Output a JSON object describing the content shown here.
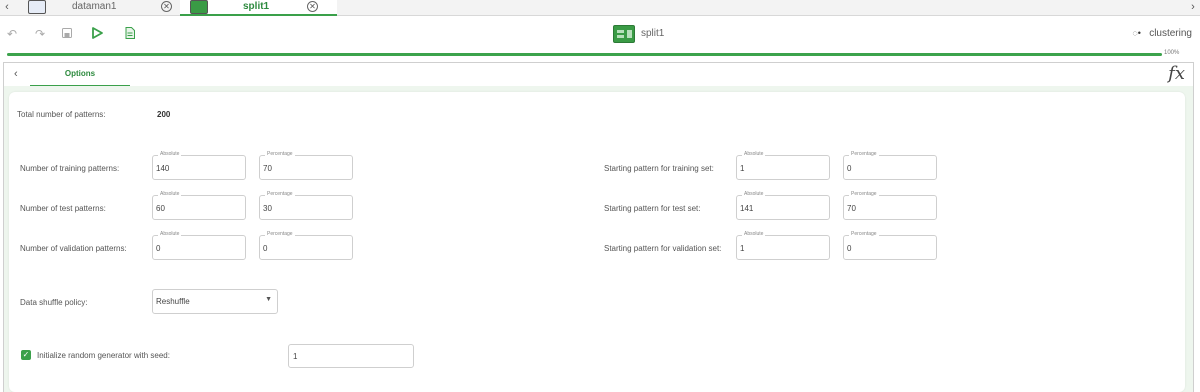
{
  "tabs": [
    {
      "label": "dataman1",
      "active": false
    },
    {
      "label": "split1",
      "active": true
    }
  ],
  "toolbar": {
    "title": "split1",
    "right_label": "clustering",
    "icons": [
      "undo-icon",
      "redo-icon",
      "save-icon",
      "run-icon",
      "document-icon"
    ]
  },
  "progress": {
    "value": 100,
    "label": "100%"
  },
  "options_tab": "Options",
  "fx_label": "fx",
  "form": {
    "total_label": "Total number of patterns:",
    "total_value": "200",
    "absolute_caption": "Absolute",
    "percentage_caption": "Percentage",
    "rows": [
      {
        "label": "Number of training patterns:",
        "absolute": "140",
        "percentage": "70",
        "start_label": "Starting pattern for training set:",
        "start_absolute": "1",
        "start_percentage": "0"
      },
      {
        "label": "Number of test patterns:",
        "absolute": "60",
        "percentage": "30",
        "start_label": "Starting pattern for test set:",
        "start_absolute": "141",
        "start_percentage": "70"
      },
      {
        "label": "Number of validation patterns:",
        "absolute": "0",
        "percentage": "0",
        "start_label": "Starting pattern for validation set:",
        "start_absolute": "1",
        "start_percentage": "0"
      }
    ],
    "shuffle_label": "Data shuffle policy:",
    "shuffle_value": "Reshuffle",
    "seed_label": "Initialize random generator with seed:",
    "seed_value": "1",
    "seed_checked": true
  },
  "colors": {
    "accent": "#3aa04a",
    "accent_text": "#2d8a3e"
  }
}
